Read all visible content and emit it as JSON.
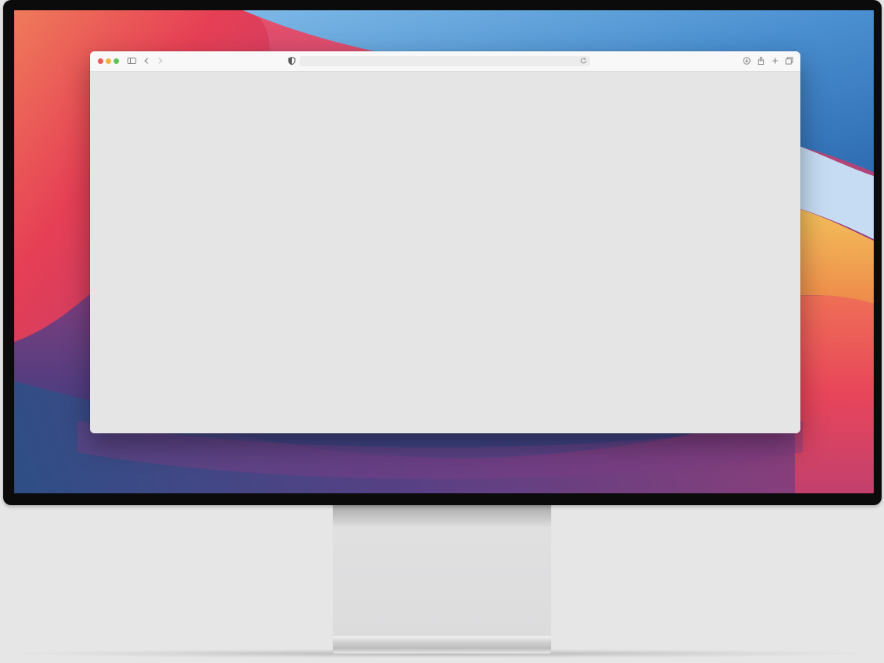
{
  "device": {
    "name": "desktop monitor"
  },
  "wallpaper": {
    "colors": {
      "blue": "#3f86cc",
      "red": "#e8475a",
      "purple": "#5b3f84",
      "orange": "#f0a04b"
    }
  },
  "browser": {
    "traffic_lights": {
      "close": "#ee5b56",
      "minimize": "#f5b33f",
      "zoom": "#5fc453"
    },
    "toolbar": {
      "sidebar_icon": "sidebar-icon",
      "back_icon": "chevron-left-icon",
      "forward_icon": "chevron-right-icon",
      "privacy_icon": "shield-icon",
      "reload_icon": "reload-icon",
      "download_icon": "download-icon",
      "share_icon": "share-icon",
      "new_tab_icon": "plus-icon",
      "tabs_icon": "tab-overview-icon"
    },
    "address_bar": {
      "value": ""
    },
    "content": {
      "background": "#e5e5e5"
    }
  }
}
